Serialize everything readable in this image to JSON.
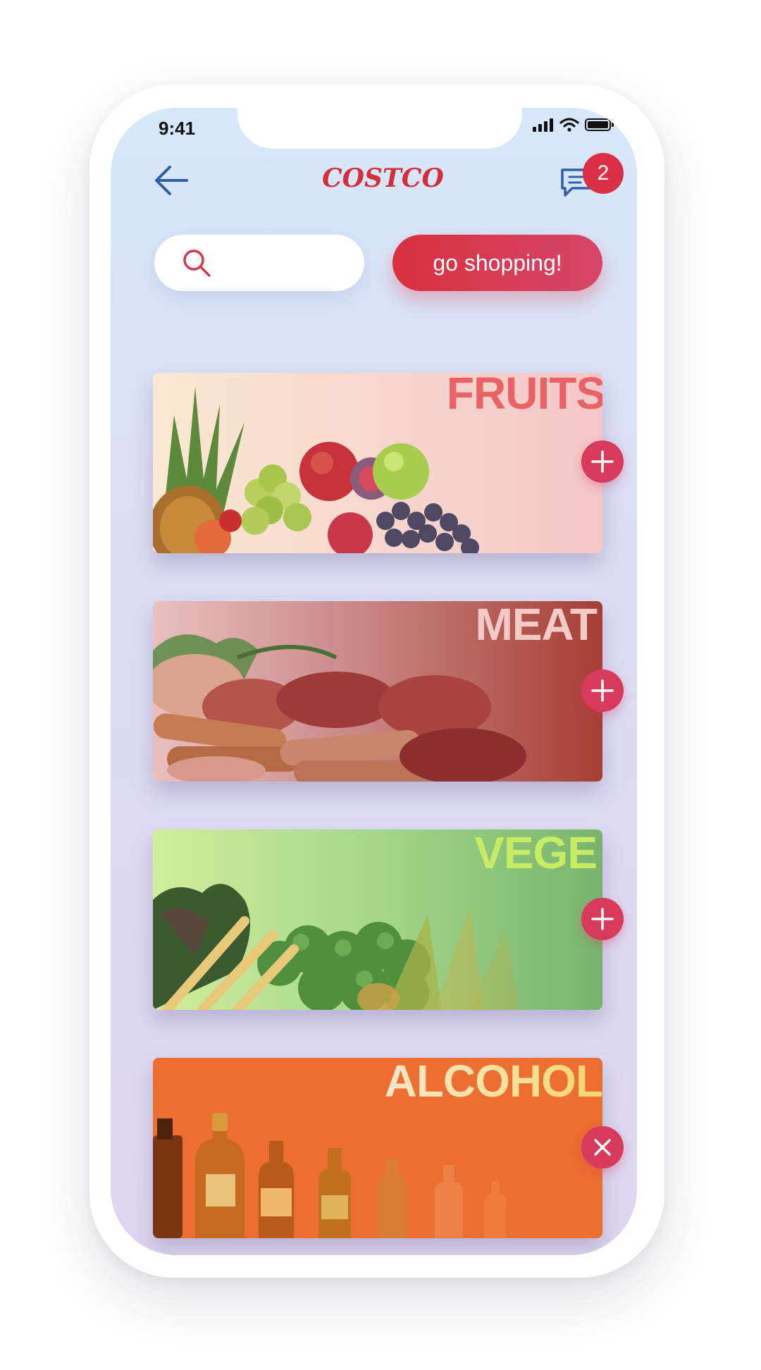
{
  "status_bar": {
    "time": "9:41"
  },
  "header": {
    "logo": "COSTCO",
    "chat_badge_count": "2"
  },
  "search": {
    "placeholder": "",
    "value": ""
  },
  "shop_button_label": "go shopping!",
  "categories": [
    {
      "title": "FRUITS",
      "action": "add"
    },
    {
      "title": "MEAT",
      "action": "add"
    },
    {
      "title": "VEGE",
      "action": "add"
    },
    {
      "title": "ALCOHOL",
      "action": "remove"
    }
  ],
  "colors": {
    "accent": "#d8313f",
    "badge": "#d93047",
    "action_button": "#d83a5c",
    "back_arrow": "#2f5fa8"
  }
}
